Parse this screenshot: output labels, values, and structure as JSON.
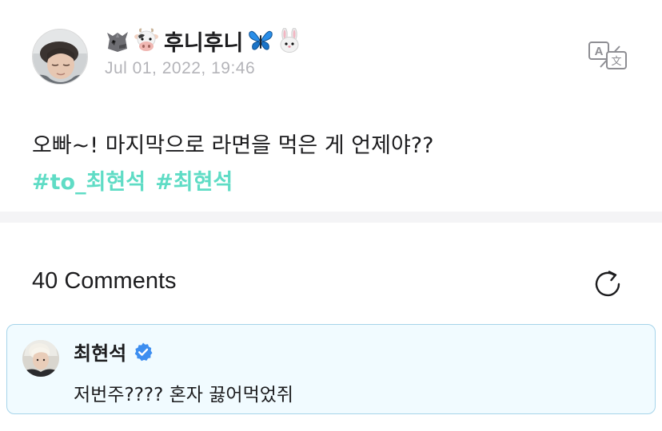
{
  "post": {
    "author": {
      "name": "후니후니",
      "emojis": [
        "wolf-emoji",
        "cow-emoji",
        "butterfly-emoji",
        "rabbit-emoji"
      ]
    },
    "date": "Jul 01, 2022, 19:46",
    "text": "오빠~! 마지막으로 라면을 먹은 게 언제야??",
    "hashtags": [
      "#to_최현석",
      "#최현석"
    ],
    "translate_icon": "translate-icon"
  },
  "comments": {
    "title": "40 Comments",
    "refresh_icon": "refresh-icon",
    "items": [
      {
        "author": "최현석",
        "verified": true,
        "text": "저번주???? 혼자 끓어먹었쥐"
      }
    ]
  },
  "colors": {
    "hashtag": "#5fdcc5",
    "date": "#b4b4b9",
    "card_background": "#f1fbff",
    "card_border": "#a6d4ea",
    "verified_badge": "#3d8ef0",
    "divider": "#f4f4f6"
  }
}
